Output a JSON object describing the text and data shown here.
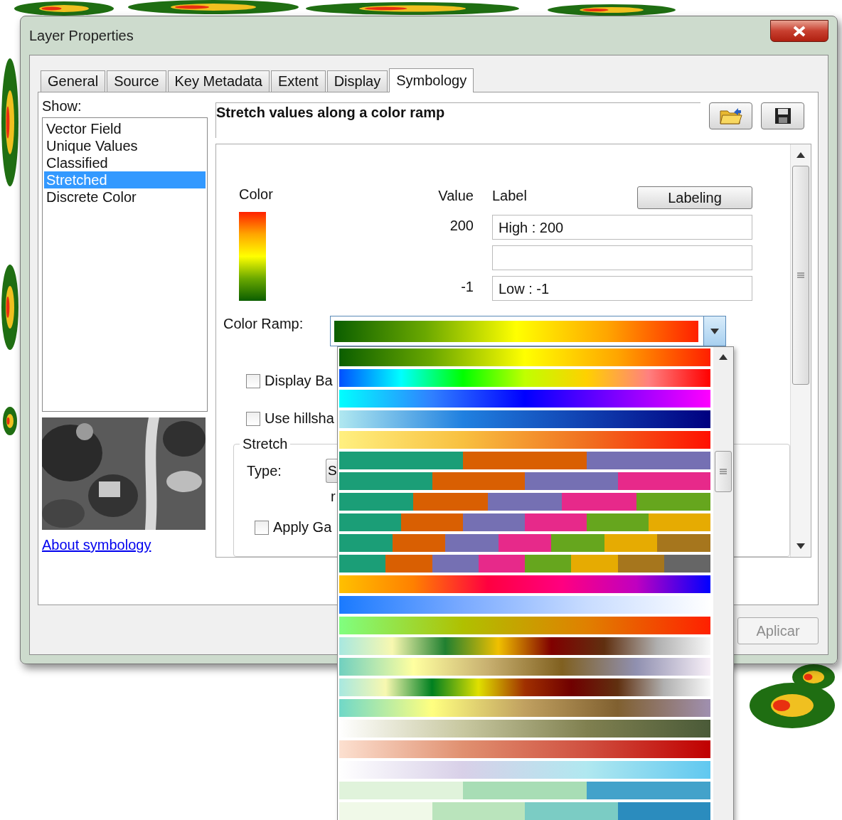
{
  "window": {
    "title": "Layer Properties"
  },
  "tabs": [
    {
      "label": "General",
      "selected": false
    },
    {
      "label": "Source",
      "selected": false
    },
    {
      "label": "Key Metadata",
      "selected": false
    },
    {
      "label": "Extent",
      "selected": false
    },
    {
      "label": "Display",
      "selected": false
    },
    {
      "label": "Symbology",
      "selected": true
    }
  ],
  "show": {
    "label": "Show:",
    "items": [
      {
        "label": "Vector Field",
        "selected": false
      },
      {
        "label": "Unique Values",
        "selected": false
      },
      {
        "label": "Classified",
        "selected": false
      },
      {
        "label": "Stretched",
        "selected": true
      },
      {
        "label": "Discrete Color",
        "selected": false
      }
    ]
  },
  "about_link": "About symbology",
  "heading": "Stretch values along a color ramp",
  "legend": {
    "color_header": "Color",
    "value_header": "Value",
    "label_header": "Label",
    "labeling_button": "Labeling",
    "rows": [
      {
        "value": "200",
        "label": "High : 200"
      },
      {
        "value": "",
        "label": ""
      },
      {
        "value": "-1",
        "label": "Low : -1"
      }
    ]
  },
  "color_ramp": {
    "label": "Color Ramp:"
  },
  "options": [
    {
      "label": "Display Ba",
      "checked": false
    },
    {
      "label": "Use hillsha",
      "checked": false
    }
  ],
  "stretch": {
    "title": "Stretch",
    "type_label": "Type:",
    "type_value": "S",
    "row_label": "r",
    "gamma": {
      "label": "Apply Ga",
      "checked": false
    }
  },
  "buttons": [
    {
      "label": "Aplicar",
      "disabled": true
    }
  ]
}
